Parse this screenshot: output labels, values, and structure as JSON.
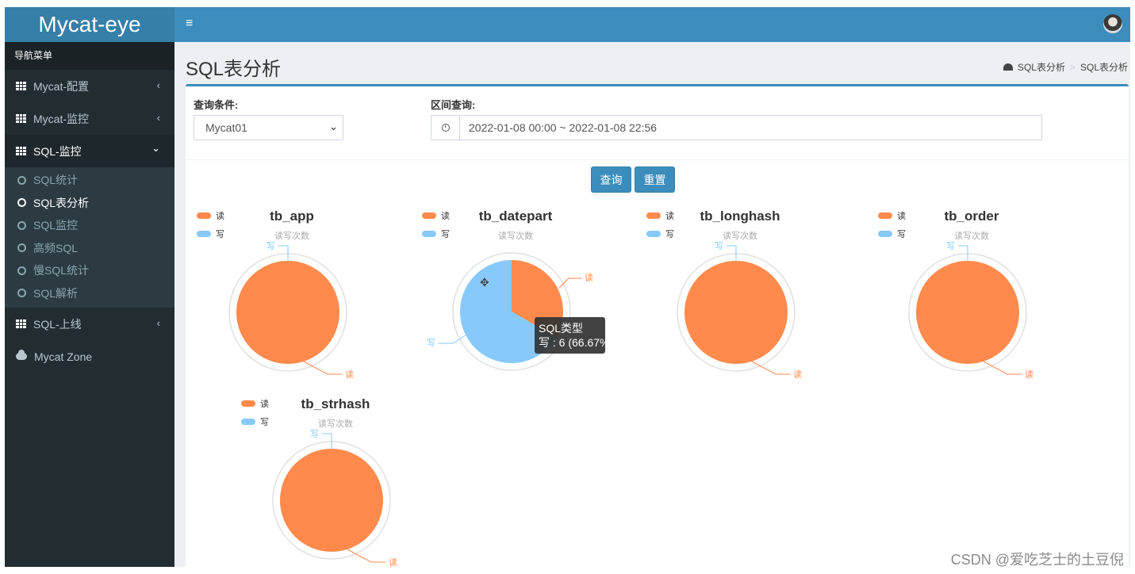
{
  "app": {
    "logo": "Mycat-eye",
    "hamburger": "≡"
  },
  "sidebar": {
    "header": "导航菜单",
    "menu": [
      {
        "label": "Mycat-配置",
        "chev": "‹"
      },
      {
        "label": "Mycat-监控",
        "chev": "‹"
      },
      {
        "label": "SQL-监控",
        "chev": "⌄"
      }
    ],
    "submenu": [
      "SQL统计",
      "SQL表分析",
      "SQL监控",
      "高频SQL",
      "慢SQL统计",
      "SQL解析"
    ],
    "menu2": {
      "label": "SQL-上线",
      "chev": "‹"
    },
    "zone": "Mycat Zone"
  },
  "page": {
    "title": "SQL表分析",
    "breadcrumb": [
      "SQL表分析",
      ">",
      "SQL表分析"
    ]
  },
  "filters": {
    "condition_label": "查询条件:",
    "condition_value": "Mycat01",
    "range_label": "区间查询:",
    "range_value": "2022-01-08 00:00 ~ 2022-01-08 22:56",
    "search_button": "查询",
    "reset_button": "重置"
  },
  "tooltip": {
    "title": "SQL类型",
    "line": "写 : 6 (66.67%)"
  },
  "watermark": "CSDN @爱吃芝士的土豆倪",
  "colors": {
    "read": "#ff8a4c",
    "write": "#87c9fa",
    "accent": "#3c8dbc"
  },
  "chart_data": [
    {
      "type": "pie",
      "title": "tb_app",
      "subtitle": "读写次数",
      "legend": [
        "读",
        "写"
      ],
      "slices": [
        {
          "name": "读",
          "value": 1
        },
        {
          "name": "写",
          "value": 0
        }
      ]
    },
    {
      "type": "pie",
      "title": "tb_datepart",
      "subtitle": "读写次数",
      "legend": [
        "读",
        "写"
      ],
      "slices": [
        {
          "name": "读",
          "value": 3
        },
        {
          "name": "写",
          "value": 6
        }
      ]
    },
    {
      "type": "pie",
      "title": "tb_longhash",
      "subtitle": "读写次数",
      "legend": [
        "读",
        "写"
      ],
      "slices": [
        {
          "name": "读",
          "value": 1
        },
        {
          "name": "写",
          "value": 0
        }
      ]
    },
    {
      "type": "pie",
      "title": "tb_order",
      "subtitle": "读写次数",
      "legend": [
        "读",
        "写"
      ],
      "slices": [
        {
          "name": "读",
          "value": 1
        },
        {
          "name": "写",
          "value": 0
        }
      ]
    },
    {
      "type": "pie",
      "title": "tb_strhash",
      "subtitle": "读写次数",
      "legend": [
        "读",
        "写"
      ],
      "slices": [
        {
          "name": "读",
          "value": 1
        },
        {
          "name": "写",
          "value": 0
        }
      ]
    }
  ]
}
